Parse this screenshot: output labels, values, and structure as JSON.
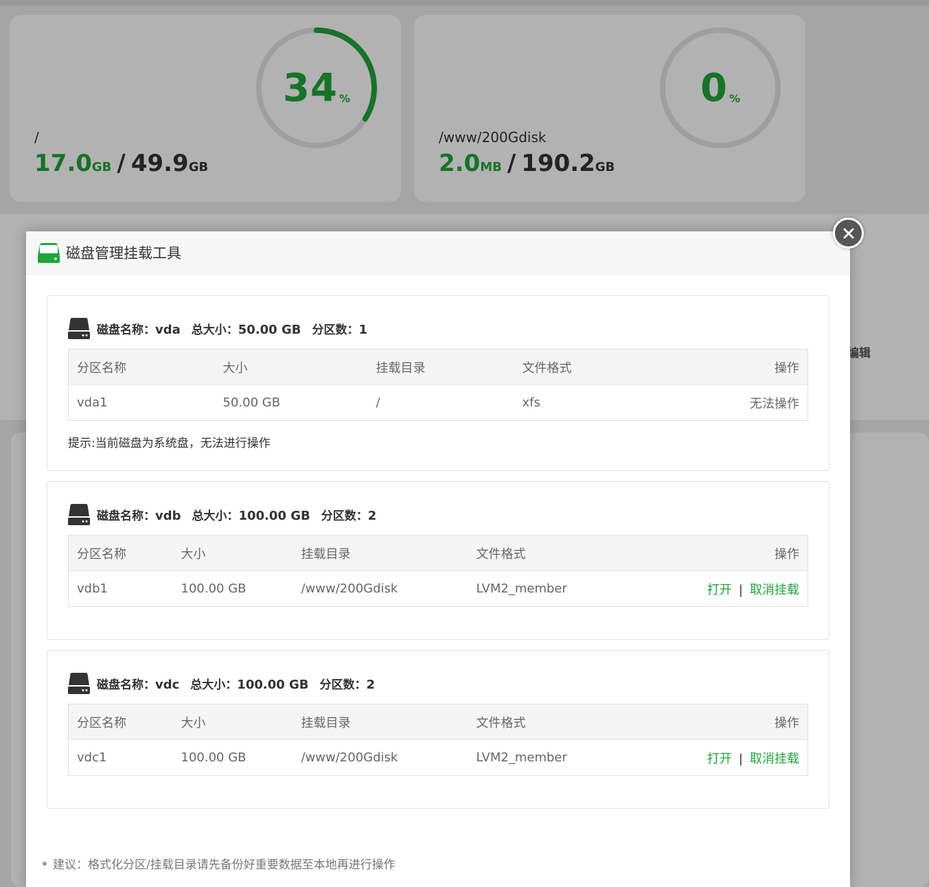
{
  "background": {
    "cards": [
      {
        "percent": "34",
        "percent_value": 34,
        "percent_sign": "%",
        "mount": "/",
        "used": "17.0",
        "used_unit": "GB",
        "separator": "/",
        "total": "49.9",
        "total_unit": "GB"
      },
      {
        "percent": "0",
        "percent_value": 0,
        "percent_sign": "%",
        "mount": "/www/200Gdisk",
        "used": "2.0",
        "used_unit": "MB",
        "separator": "/",
        "total": "190.2",
        "total_unit": "GB"
      }
    ],
    "edit_label": "编辑"
  },
  "modal": {
    "title": "磁盘管理挂载工具",
    "disks": [
      {
        "name_label": "磁盘名称：",
        "name": "vda",
        "size_label": "总大小：",
        "size": "50.00 GB",
        "parts_label": "分区数：",
        "parts": "1",
        "columns": [
          "分区名称",
          "大小",
          "挂载目录",
          "文件格式",
          "操作"
        ],
        "rows": [
          {
            "partition": "vda1",
            "size": "50.00 GB",
            "mount": "/",
            "fs": "xfs",
            "op_text": "无法操作"
          }
        ],
        "tip": "提示:当前磁盘为系统盘，无法进行操作"
      },
      {
        "name_label": "磁盘名称：",
        "name": "vdb",
        "size_label": "总大小：",
        "size": "100.00 GB",
        "parts_label": "分区数：",
        "parts": "2",
        "columns": [
          "分区名称",
          "大小",
          "挂载目录",
          "文件格式",
          "操作"
        ],
        "rows": [
          {
            "partition": "vdb1",
            "size": "100.00 GB",
            "mount": "/www/200Gdisk",
            "fs": "LVM2_member",
            "open": "打开",
            "pipe": "|",
            "unmount": "取消挂载"
          }
        ]
      },
      {
        "name_label": "磁盘名称：",
        "name": "vdc",
        "size_label": "总大小：",
        "size": "100.00 GB",
        "parts_label": "分区数：",
        "parts": "2",
        "columns": [
          "分区名称",
          "大小",
          "挂载目录",
          "文件格式",
          "操作"
        ],
        "rows": [
          {
            "partition": "vdc1",
            "size": "100.00 GB",
            "mount": "/www/200Gdisk",
            "fs": "LVM2_member",
            "open": "打开",
            "pipe": "|",
            "unmount": "取消挂载"
          }
        ]
      }
    ],
    "advice": "建议：格式化分区/挂载目录请先备份好重要数据至本地再进行操作"
  },
  "colors": {
    "accent": "#20a53a",
    "ring_track": "#e4e4e4",
    "overlay": "rgba(0,0,0,0.3)"
  }
}
